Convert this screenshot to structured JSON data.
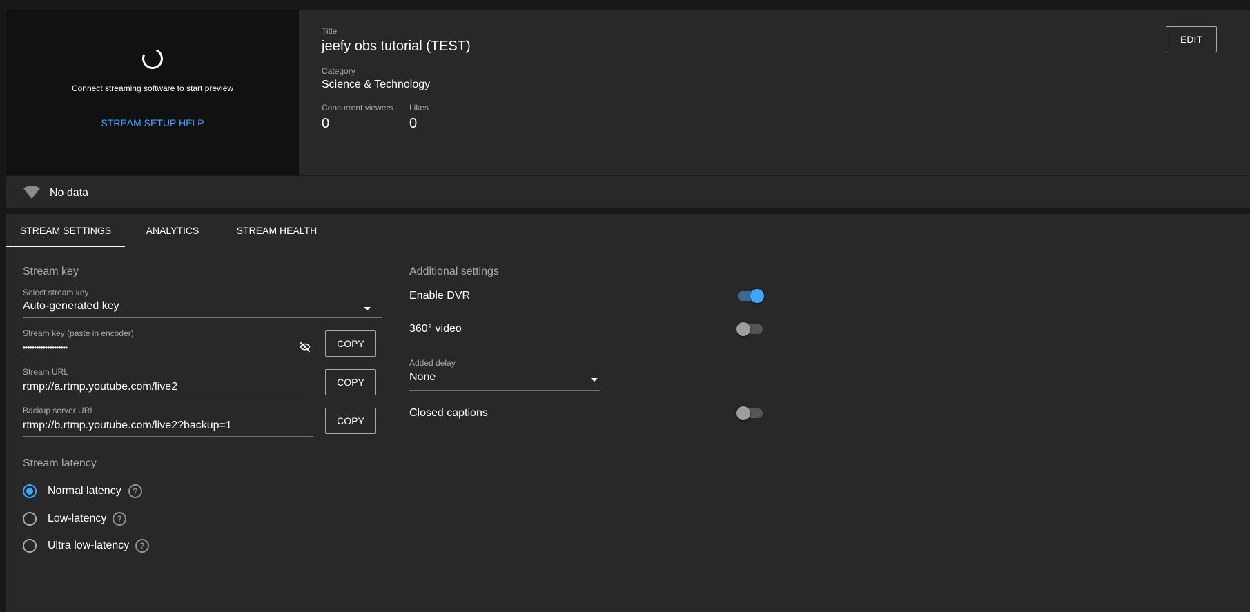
{
  "preview": {
    "message": "Connect streaming software to start preview",
    "setup_help": "STREAM SETUP HELP"
  },
  "info": {
    "title_label": "Title",
    "title": "jeefy obs tutorial (TEST)",
    "category_label": "Category",
    "category": "Science & Technology",
    "viewers_label": "Concurrent viewers",
    "viewers": "0",
    "likes_label": "Likes",
    "likes": "0",
    "edit_label": "EDIT"
  },
  "health": {
    "status": "No data"
  },
  "tabs": [
    {
      "label": "STREAM SETTINGS",
      "active": true
    },
    {
      "label": "ANALYTICS",
      "active": false
    },
    {
      "label": "STREAM HEALTH",
      "active": false
    }
  ],
  "stream_key": {
    "section_title": "Stream key",
    "select_label": "Select stream key",
    "select_value": "Auto-generated key",
    "key_label": "Stream key (paste in encoder)",
    "key_value": "••••••••••••••••••••",
    "url_label": "Stream URL",
    "url_value": "rtmp://a.rtmp.youtube.com/live2",
    "backup_label": "Backup server URL",
    "backup_value": "rtmp://b.rtmp.youtube.com/live2?backup=1",
    "copy_label": "COPY"
  },
  "latency": {
    "section_title": "Stream latency",
    "options": [
      {
        "label": "Normal latency",
        "selected": true
      },
      {
        "label": "Low-latency",
        "selected": false
      },
      {
        "label": "Ultra low-latency",
        "selected": false
      }
    ]
  },
  "additional": {
    "section_title": "Additional settings",
    "dvr_label": "Enable DVR",
    "dvr_on": true,
    "video360_label": "360° video",
    "video360_on": false,
    "delay_label": "Added delay",
    "delay_value": "None",
    "captions_label": "Closed captions",
    "captions_on": false
  },
  "colors": {
    "accent": "#3ea6ff",
    "background": "#181818",
    "card": "#282828"
  }
}
